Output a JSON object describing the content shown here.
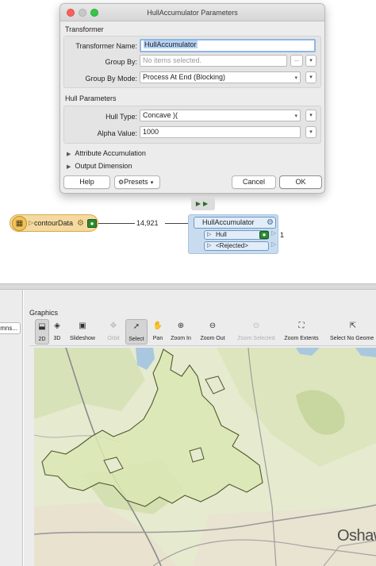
{
  "dialog": {
    "title": "HullAccumulator Parameters",
    "section_transformer": "Transformer",
    "transformer_name_label": "Transformer Name:",
    "transformer_name_value": "HullAccumulator",
    "group_by_label": "Group By:",
    "group_by_placeholder": "No items selected.",
    "group_by_more": "...",
    "group_by_mode_label": "Group By Mode:",
    "group_by_mode_value": "Process At End (Blocking)",
    "section_hull": "Hull Parameters",
    "hull_type_label": "Hull Type:",
    "hull_type_value": "Concave )(",
    "alpha_value_label": "Alpha Value:",
    "alpha_value_value": "1000",
    "attribute_accumulation": "Attribute Accumulation",
    "output_dimension": "Output Dimension",
    "help_button": "Help",
    "presets_button": "Presets",
    "cancel_button": "Cancel",
    "ok_button": "OK"
  },
  "workspace": {
    "reader_name": "contourData",
    "feature_count": "14,921",
    "transformer_name": "HullAccumulator",
    "port_hull": "Hull",
    "port_hull_count": "1",
    "port_rejected": "<Rejected>"
  },
  "graphics": {
    "pane_title": "Graphics",
    "left_button": "mns...",
    "tools": [
      {
        "label": "2D",
        "icon": "2d-view-icon"
      },
      {
        "label": "3D",
        "icon": "3d-view-icon"
      },
      {
        "label": "Slideshow",
        "icon": "slideshow-icon"
      },
      {
        "label": "Orbit",
        "icon": "orbit-icon"
      },
      {
        "label": "Select",
        "icon": "select-arrow-icon"
      },
      {
        "label": "Pan",
        "icon": "hand-icon"
      },
      {
        "label": "Zoom In",
        "icon": "zoom-in-icon"
      },
      {
        "label": "Zoom Out",
        "icon": "zoom-out-icon"
      },
      {
        "label": "Zoom Selected",
        "icon": "zoom-selected-icon"
      },
      {
        "label": "Zoom Extents",
        "icon": "zoom-extents-icon"
      },
      {
        "label": "Select No Geome",
        "icon": "select-no-geometry-icon"
      }
    ],
    "map_label": "Oshaw"
  },
  "colors": {
    "hull_fill": "#dbe8b4",
    "hull_stroke": "#4d5a2e",
    "reader_fill": "#f4d9a0",
    "transformer_fill": "#c9dcef"
  }
}
